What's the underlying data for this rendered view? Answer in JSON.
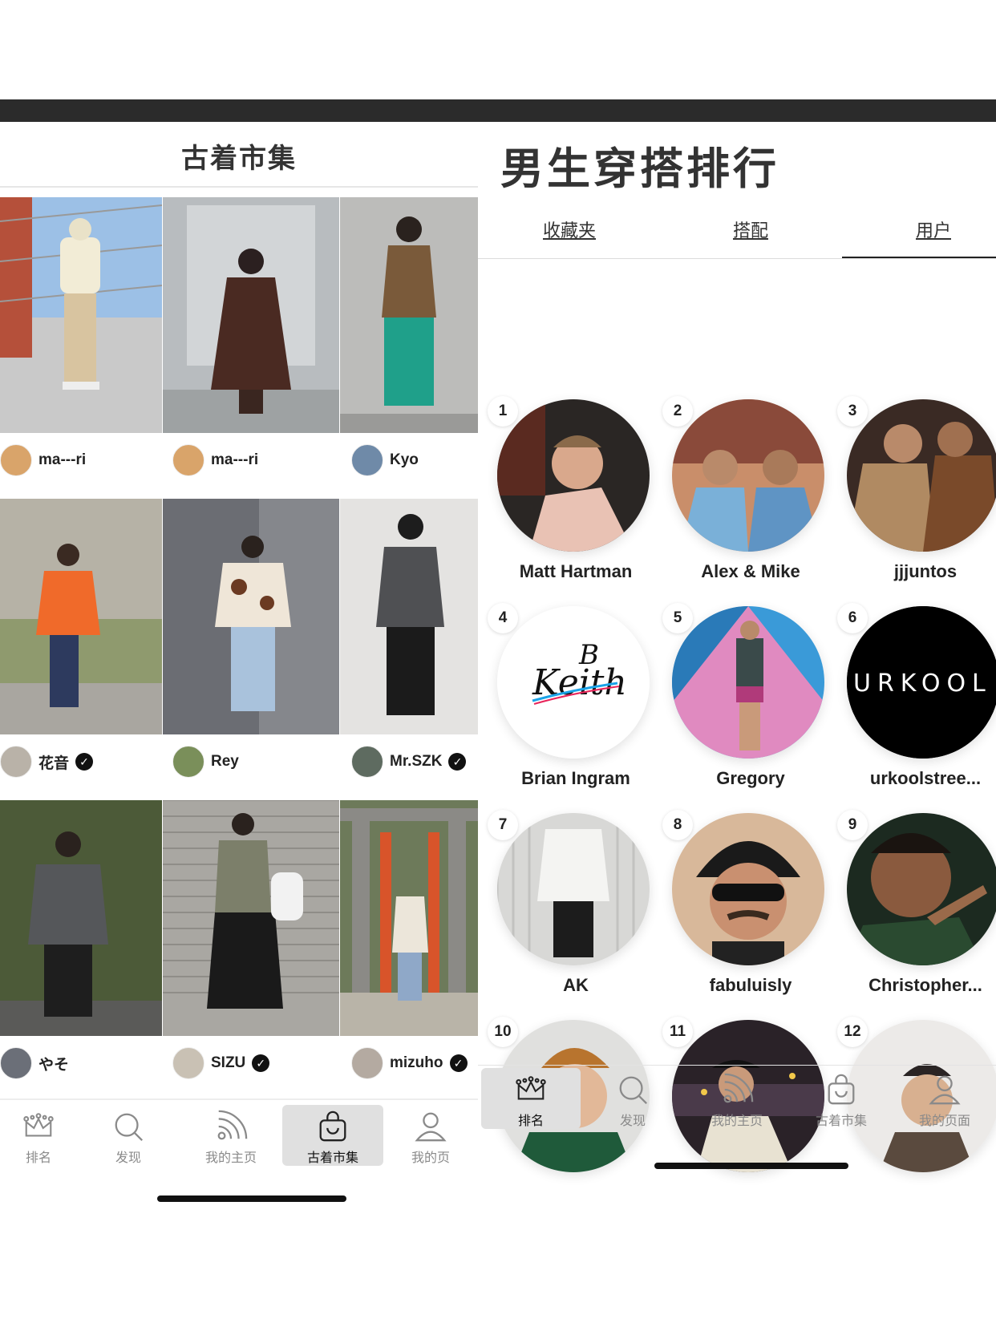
{
  "left_panel": {
    "title": "古着市集",
    "posts": [
      {
        "user": "ma---ri",
        "verified": false,
        "avatar_color": "#d9a46a"
      },
      {
        "user": "ma---ri",
        "verified": false,
        "avatar_color": "#d9a46a"
      },
      {
        "user": "Kyo",
        "verified": false,
        "avatar_color": "#6f8aa8"
      },
      {
        "user": "花音",
        "verified": true,
        "avatar_color": "#b9b2a8"
      },
      {
        "user": "Rey",
        "verified": false,
        "avatar_color": "#7a8f5a"
      },
      {
        "user": "Mr.SZK",
        "verified": true,
        "avatar_color": "#5e6b60"
      },
      {
        "user": "やそ",
        "verified": false,
        "avatar_color": "#6b6f78"
      },
      {
        "user": "SIZU",
        "verified": true,
        "avatar_color": "#c9c1b4"
      },
      {
        "user": "mizuho",
        "verified": true,
        "avatar_color": "#b4aaa1"
      }
    ],
    "nav": [
      {
        "label": "排名",
        "icon": "crown-icon"
      },
      {
        "label": "发现",
        "icon": "search-icon"
      },
      {
        "label": "我的主页",
        "icon": "feed-icon"
      },
      {
        "label": "古着市集",
        "icon": "shopping-bag-icon",
        "active": true
      },
      {
        "label": "我的页",
        "icon": "person-icon"
      }
    ]
  },
  "right_panel": {
    "title": "男生穿搭排行",
    "tabs": [
      "收藏夹",
      "搭配",
      "用户"
    ],
    "active_tab": "用户",
    "rankings": [
      {
        "rank": "1",
        "name": "Matt Hartman"
      },
      {
        "rank": "2",
        "name": "Alex & Mike"
      },
      {
        "rank": "3",
        "name": "jjjuntos"
      },
      {
        "rank": "4",
        "name": "Brian Ingram",
        "logo_text": "Keith",
        "logo_mark": "B"
      },
      {
        "rank": "5",
        "name": "Gregory"
      },
      {
        "rank": "6",
        "name": "urkoolstree...",
        "logo_text": "URKOOL"
      },
      {
        "rank": "7",
        "name": "AK"
      },
      {
        "rank": "8",
        "name": "fabuluisly"
      },
      {
        "rank": "9",
        "name": "Christopher..."
      },
      {
        "rank": "10",
        "name": ""
      },
      {
        "rank": "11",
        "name": ""
      },
      {
        "rank": "12",
        "name": ""
      }
    ],
    "nav": [
      {
        "label": "排名",
        "icon": "crown-icon",
        "active": true
      },
      {
        "label": "发现",
        "icon": "search-icon"
      },
      {
        "label": "我的主页",
        "icon": "feed-icon"
      },
      {
        "label": "古着市集",
        "icon": "shopping-bag-icon"
      },
      {
        "label": "我的页面",
        "icon": "person-icon"
      }
    ]
  },
  "colors": {
    "verify_badge": "#111111",
    "nav_inactive": "#8a8a8a",
    "nav_active_bg": "#e0e0e0"
  }
}
